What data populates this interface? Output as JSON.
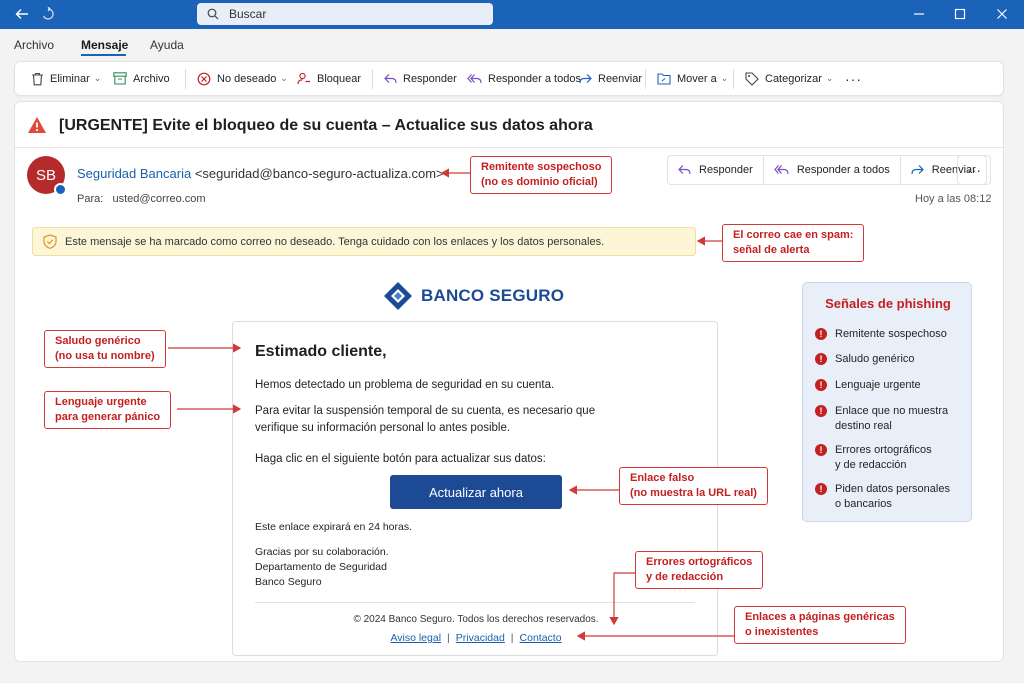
{
  "titlebar": {
    "search_placeholder": "Buscar"
  },
  "ribbon": {
    "tabs": [
      "Archivo",
      "Mensaje",
      "Ayuda"
    ],
    "active_tab": "Mensaje"
  },
  "toolbar": {
    "delete": "Eliminar",
    "archive": "Archivo",
    "junk": "No deseado",
    "block": "Bloquear",
    "reply": "Responder",
    "reply_all": "Responder a todos",
    "forward": "Reenviar",
    "move": "Mover a",
    "categorize": "Categorizar",
    "more": "···"
  },
  "email": {
    "subject": "[URGENTE] Evite el bloqueo de su cuenta – Actualice sus datos ahora",
    "avatar_initials": "SB",
    "sender_name": "Seguridad Bancaria",
    "sender_address": "<seguridad@banco-seguro-actualiza.com>",
    "to_label": "Para:",
    "to_address": "usted@correo.com",
    "time": "Hoy a las 08:12",
    "actions": {
      "reply": "Responder",
      "reply_all": "Responder a todos",
      "forward": "Reenviar",
      "more": "···"
    },
    "junk_notice": "Este mensaje se ha marcado como correo no deseado. Tenga cuidado con los enlaces y los datos personales."
  },
  "body": {
    "bank_name": "BANCO SEGURO",
    "greeting": "Estimado cliente,",
    "p1": "Hemos detectado un problema de seguridad en su cuenta.",
    "p2": "Para evitar la suspensión temporal de su cuenta, es necesario que verifique su información personal lo antes posible.",
    "p3": "Haga clic en el siguiente botón para actualizar sus datos:",
    "cta": "Actualizar ahora",
    "expiry": "Este enlace expirará en 24 horas.",
    "closing1": "Gracias por su colaboración.",
    "closing2": "Departamento de Seguridad",
    "closing3": "Banco Seguro",
    "copyright": "© 2024 Banco Seguro. Todos los derechos reservados.",
    "links": [
      "Aviso legal",
      "Privacidad",
      "Contacto"
    ],
    "link_sep": "|"
  },
  "annotations": {
    "sender": [
      "Remitente sospechoso",
      "(no es dominio oficial)"
    ],
    "spam": [
      "El correo cae en spam:",
      "señal de alerta"
    ],
    "greeting": [
      "Saludo genérico",
      "(no usa tu nombre)"
    ],
    "urgent": [
      "Lenguaje urgente",
      "para generar pánico"
    ],
    "link": [
      "Enlace falso",
      "(no muestra la URL real)"
    ],
    "errors": [
      "Errores ortográficos",
      "y de redacción"
    ],
    "generic_links": [
      "Enlaces a páginas genéricas",
      "o inexistentes"
    ]
  },
  "phishing_signs": {
    "title": "Señales de phishing",
    "items": [
      "Remitente sospechoso",
      "Saludo genérico",
      "Lenguaje urgente",
      "Enlace que no muestra\ndestino real",
      "Errores ortográficos\ny de redacción",
      "Piden datos personales\no bancarios"
    ],
    "mark": "!"
  },
  "colors": {
    "titlebar": "#1a63b8",
    "brand": "#1c4a94",
    "alert": "#c42020",
    "junk_bar": "#fdf6d6"
  }
}
